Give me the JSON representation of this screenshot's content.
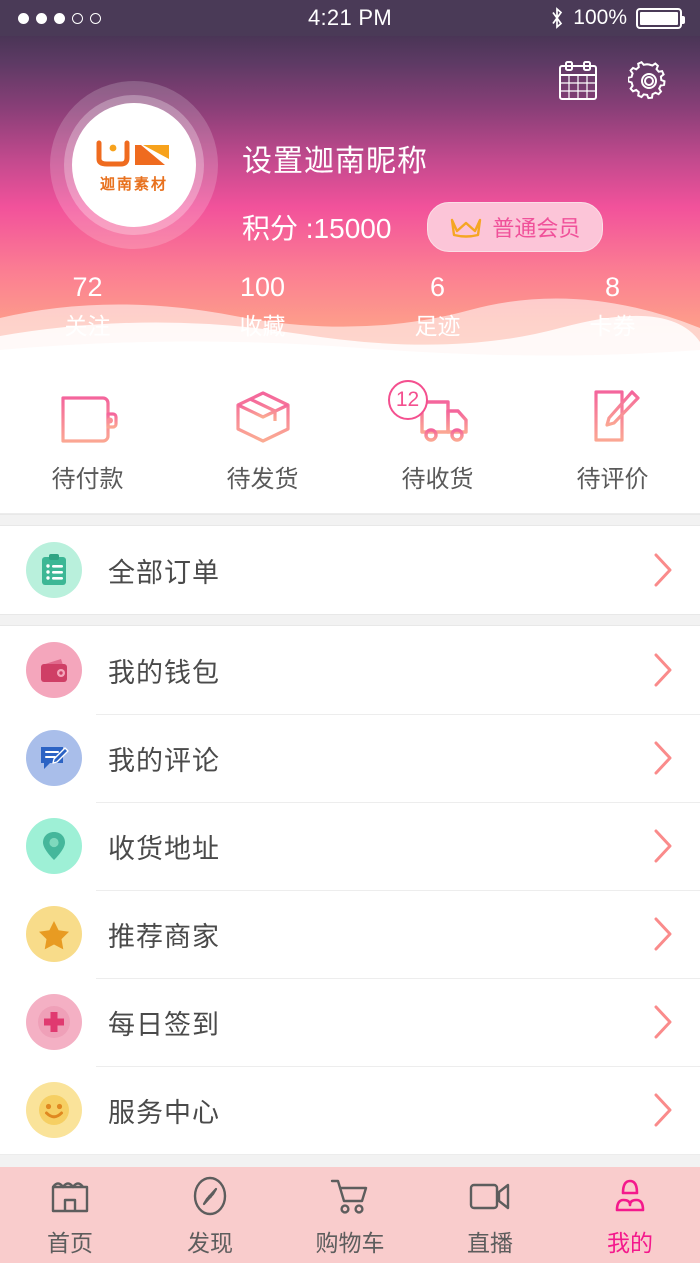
{
  "statusbar": {
    "time": "4:21 PM",
    "battery_percent": "100%",
    "signal_dots_filled": 3,
    "signal_dots_total": 5,
    "bluetooth_icon": "bluetooth-icon",
    "battery_icon": "battery-full-icon"
  },
  "header": {
    "nickname": "设置迦南昵称",
    "points": "积分 :15000",
    "vip_label": "普通会员",
    "vip_icon": "crown-icon",
    "calendar_icon": "calendar-icon",
    "settings_icon": "gear-icon",
    "avatar": {
      "logo_text": "迦南素材",
      "logo_mark": "jn-logo-icon"
    },
    "accent_pink": "#f4508f",
    "accent_coral": "#fd9a8b",
    "stats": [
      {
        "value": "72",
        "label": "关注"
      },
      {
        "value": "100",
        "label": "收藏"
      },
      {
        "value": "6",
        "label": "足迹"
      },
      {
        "value": "8",
        "label": "卡券"
      }
    ]
  },
  "orders": [
    {
      "label": "待付款",
      "icon": "wallet-icon",
      "badge": ""
    },
    {
      "label": "待发货",
      "icon": "box-icon",
      "badge": ""
    },
    {
      "label": "待收货",
      "icon": "truck-icon",
      "badge": "12"
    },
    {
      "label": "待评价",
      "icon": "review-icon",
      "badge": ""
    }
  ],
  "menu_section_1": [
    {
      "label": "全部订单",
      "icon": "clipboard-icon",
      "bg": "#b9f0dc",
      "fg": "#3cb795"
    }
  ],
  "menu_section_2": [
    {
      "label": "我的钱包",
      "icon": "wallet-filled-icon",
      "bg": "#f4a6bc",
      "fg": "#cf3f66"
    },
    {
      "label": "我的评论",
      "icon": "comment-edit-icon",
      "bg": "#a9beea",
      "fg": "#2c63c4"
    },
    {
      "label": "收货地址",
      "icon": "location-pin-icon",
      "bg": "#9ef0d6",
      "fg": "#45b79b"
    },
    {
      "label": "推荐商家",
      "icon": "star-icon",
      "bg": "#f8dc8a",
      "fg": "#e89b22"
    },
    {
      "label": "每日签到",
      "icon": "plus-circle-icon",
      "bg": "#f4b0c4",
      "fg": "#e03a70"
    },
    {
      "label": "服务中心",
      "icon": "smiley-icon",
      "bg": "#fae39a",
      "fg": "#efa932"
    }
  ],
  "tabbar": {
    "active_color": "#f4198c",
    "inactive_color": "#5d5d5d",
    "items": [
      {
        "label": "首页",
        "icon": "shop-icon",
        "active": false
      },
      {
        "label": "发现",
        "icon": "compass-icon",
        "active": false
      },
      {
        "label": "购物车",
        "icon": "cart-icon",
        "active": false
      },
      {
        "label": "直播",
        "icon": "video-icon",
        "active": false
      },
      {
        "label": "我的",
        "icon": "person-icon",
        "active": true
      }
    ]
  }
}
